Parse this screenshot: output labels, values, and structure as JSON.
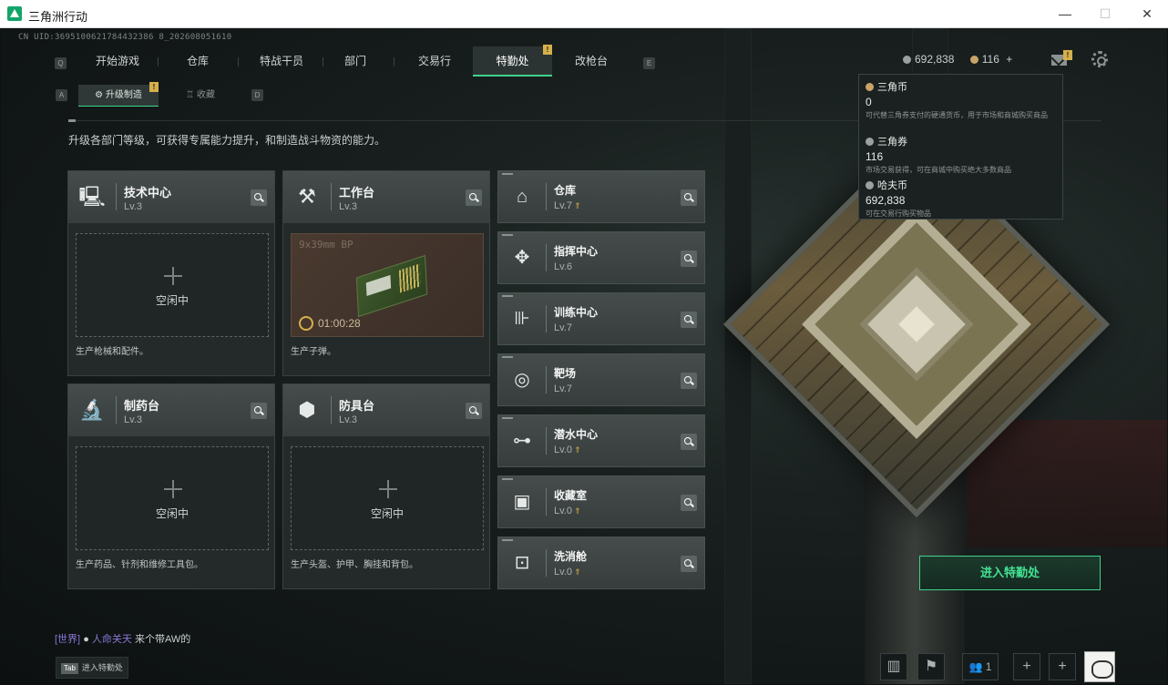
{
  "window": {
    "title": "三角洲行动"
  },
  "uid": "CN UID:3695100621784432386 8_202608051610",
  "nav": {
    "left_key": "Q",
    "right_key": "E",
    "tabs": [
      {
        "label": "开始游戏"
      },
      {
        "label": "仓库"
      },
      {
        "label": "特战干员"
      },
      {
        "label": "部门"
      },
      {
        "label": "交易行"
      },
      {
        "label": "特勤处",
        "active": true,
        "badge": "!"
      },
      {
        "label": "改枪台"
      }
    ]
  },
  "currency": {
    "hafu": "692,838",
    "sanjiao_quan": "116",
    "plus": "+"
  },
  "subnav": {
    "left_key": "A",
    "right_key": "D",
    "tabs": [
      {
        "label": "升级制造",
        "active": true,
        "badge": "!"
      },
      {
        "label": "收藏"
      }
    ]
  },
  "description": "升级各部门等级，可获得专属能力提升，和制造战斗物资的能力。",
  "workshops": [
    {
      "name": "技术中心",
      "level": "Lv.3",
      "icon": "computer-icon",
      "status": "空闲中",
      "footer": "生产枪械和配件。"
    },
    {
      "name": "工作台",
      "level": "Lv.3",
      "icon": "tools-icon",
      "status": "busy",
      "item": "9x39mm BP",
      "timer": "01:00:28",
      "footer": "生产子弹。"
    },
    {
      "name": "制药台",
      "level": "Lv.3",
      "icon": "microscope-icon",
      "status": "空闲中",
      "footer": "生产药品、针剂和维修工具包。"
    },
    {
      "name": "防具台",
      "level": "Lv.3",
      "icon": "cubes-icon",
      "status": "空闲中",
      "footer": "生产头盔、护甲、胸挂和背包。"
    }
  ],
  "departments": [
    {
      "name": "仓库",
      "level": "Lv.7",
      "upgrade": true,
      "icon": "warehouse-icon"
    },
    {
      "name": "指挥中心",
      "level": "Lv.6",
      "upgrade": false,
      "icon": "chip-icon"
    },
    {
      "name": "训练中心",
      "level": "Lv.7",
      "upgrade": false,
      "icon": "dumbbell-icon"
    },
    {
      "name": "靶场",
      "level": "Lv.7",
      "upgrade": false,
      "icon": "target-icon"
    },
    {
      "name": "潜水中心",
      "level": "Lv.0",
      "upgrade": true,
      "icon": "goggles-icon"
    },
    {
      "name": "收藏室",
      "level": "Lv.0",
      "upgrade": true,
      "icon": "vault-icon"
    },
    {
      "name": "洗消舱",
      "level": "Lv.0",
      "upgrade": true,
      "icon": "decon-icon"
    }
  ],
  "tooltip": {
    "items": [
      {
        "title": "三角币",
        "value": "0",
        "desc": "可代替三角券支付的硬通货币，用于市场和商城购买商品"
      },
      {
        "title": "三角券",
        "value": "116",
        "desc": "市场交易获得，可在商城中购买绝大多数商品"
      },
      {
        "title": "哈夫币",
        "value": "692,838",
        "desc": "可在交易行购买物品"
      }
    ]
  },
  "enter_button": "进入特勤处",
  "chat": {
    "channel": "[世界]",
    "user": "人命关天",
    "message": "来个带AW的"
  },
  "tab_hint": {
    "key": "Tab",
    "label": "进入特勤处"
  },
  "bottom": {
    "friends_count": "1"
  }
}
